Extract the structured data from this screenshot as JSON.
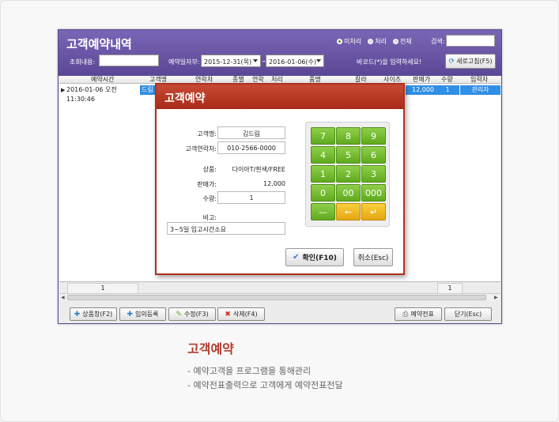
{
  "window": {
    "title": "고객예약내역",
    "filters": [
      {
        "label": "미처리",
        "checked": true
      },
      {
        "label": "처리",
        "checked": false
      },
      {
        "label": "전체",
        "checked": false
      }
    ],
    "search_label": "검색:",
    "search_value": "",
    "lookup_label": "조회내용:",
    "lookup_value": "",
    "date_label": "예약일자부:",
    "date_from": "2015-12-31(목)",
    "date_sep": "~",
    "date_to": "2016-01-06(수)",
    "barcode_hint": "바코드(*)을 입력하세요!",
    "refresh_label": "새로고침(F5)"
  },
  "grid": {
    "columns": [
      "예약시간",
      "고객명",
      "연락처",
      "종별",
      "연락",
      "처리",
      "품명",
      "칼라",
      "사이즈",
      "판매가",
      "수량",
      "입력자"
    ],
    "rows": [
      {
        "time": "2016-01-06 오전 11:30:46",
        "name": "드림",
        "price": "12,000",
        "qty": "1",
        "user": "관리자"
      }
    ],
    "footer_left": "1",
    "footer_right": "1"
  },
  "bottom_buttons": {
    "product": "상품창(F2)",
    "register": "임의등록",
    "edit": "수정(F3)",
    "delete": "삭제(F4)",
    "print": "예약전표",
    "close": "닫기(Esc)"
  },
  "modal": {
    "title": "고객예약",
    "name_label": "고객명:",
    "name_value": "김드림",
    "phone_label": "고객연락처:",
    "phone_value": "010-2566-0000",
    "product_label": "상품:",
    "product_value": "다이아T/흰색/FREE",
    "price_label": "판매가:",
    "price_value": "12,000",
    "qty_label": "수량:",
    "qty_value": "1",
    "memo_label": "비고:",
    "memo_value": "3~5일 입고시간소요",
    "keypad": [
      "7",
      "8",
      "9",
      "4",
      "5",
      "6",
      "1",
      "2",
      "3",
      "0",
      "00",
      "000",
      "—",
      "←",
      "↵"
    ],
    "confirm_label": "확인(F10)",
    "cancel_label": "취소(Esc)"
  },
  "caption": {
    "title": "고객예약",
    "lines": [
      "- 예약고객을 프로그램을 통해관리",
      "- 예약전표출력으로 고객에게 예약전표전달"
    ]
  },
  "colors": {
    "titlebar": "#6a56a8",
    "modal_title": "#b83a24",
    "key_green": "#6fb52a",
    "key_yellow": "#eeb21c",
    "caption_title": "#b23a2c"
  }
}
